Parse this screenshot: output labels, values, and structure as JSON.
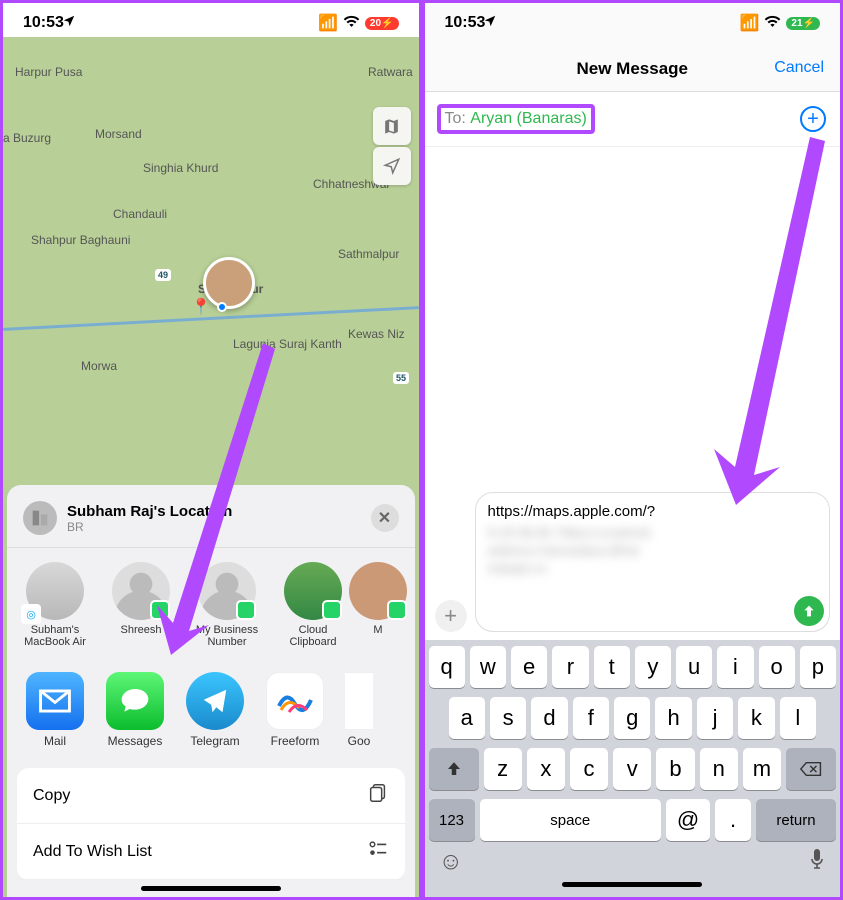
{
  "left": {
    "status": {
      "time": "10:53",
      "battery": "20"
    },
    "map": {
      "labels": [
        "Harpur Pusa",
        "Morsand",
        "a Buzurg",
        "Singhia Khurd",
        "Chandauli",
        "Shahpur Baghauni",
        "Samastipur",
        "Sathmalpur",
        "Lagunia Suraj Kanth",
        "Morwa",
        "Chhatneshwar",
        "Kewas Niz",
        "Ratwara"
      ],
      "avatar_city": "Samastipur"
    },
    "sheet": {
      "title": "Subham Raj's Location",
      "subtitle": "BR",
      "contacts": [
        {
          "name": "Subham's MacBook Air",
          "type": "airdrop"
        },
        {
          "name": "Shreesh",
          "type": "wa"
        },
        {
          "name": "My Business Number",
          "type": "wa"
        },
        {
          "name": "Cloud Clipboard",
          "type": "wa"
        },
        {
          "name": "M",
          "type": "wa"
        }
      ],
      "apps": [
        {
          "name": "Mail",
          "color": "#2196f3"
        },
        {
          "name": "Messages",
          "color": "#2bd265"
        },
        {
          "name": "Telegram",
          "color": "#29a9eb"
        },
        {
          "name": "Freeform",
          "color": "#fff"
        },
        {
          "name": "Goo",
          "color": "#fff"
        }
      ],
      "actions": [
        "Copy",
        "Add To Wish List"
      ]
    }
  },
  "right": {
    "status": {
      "time": "10:53",
      "battery": "21"
    },
    "title": "New Message",
    "cancel": "Cancel",
    "to_label": "To:",
    "to_value": "Aryan (Banaras)",
    "msg_preview": "https://maps.apple.com/?",
    "keyboard": {
      "row1": [
        "q",
        "w",
        "e",
        "r",
        "t",
        "y",
        "u",
        "i",
        "o",
        "p"
      ],
      "row2": [
        "a",
        "s",
        "d",
        "f",
        "g",
        "h",
        "j",
        "k",
        "l"
      ],
      "row3": [
        "z",
        "x",
        "c",
        "v",
        "b",
        "n",
        "m"
      ],
      "num": "123",
      "space": "space",
      "at": "@",
      "dot": ".",
      "return": "return"
    }
  }
}
